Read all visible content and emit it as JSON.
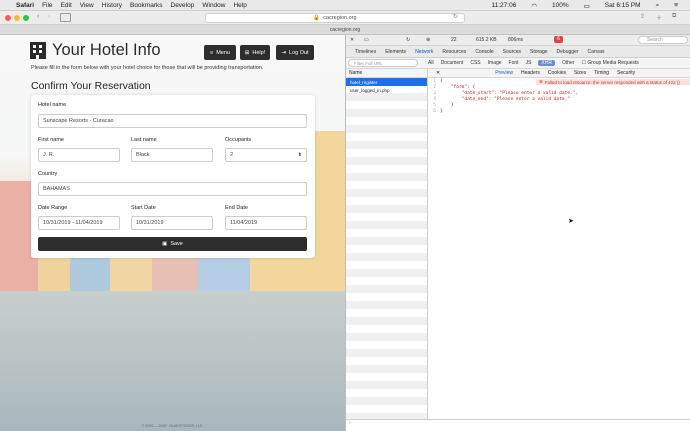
{
  "menubar": {
    "app_name": "Safari",
    "items": [
      "File",
      "Edit",
      "View",
      "History",
      "Bookmarks",
      "Develop",
      "Window",
      "Help"
    ],
    "status": {
      "time_small": "11:27:06",
      "battery": "100%",
      "clock": "Sat 6:15 PM"
    }
  },
  "browser": {
    "url": "cacregion.org",
    "tab_title": "cacregion.org"
  },
  "site": {
    "title": "Your Hotel Info",
    "nav": {
      "menu": "Menu",
      "help": "Help!",
      "logout": "Log Out"
    },
    "subtitle": "Please fill in the form below with your hotel choice for those that will be providing transportation.",
    "section_heading": "Confirm Your Reservation",
    "form": {
      "hotel_label": "Hotel name",
      "hotel_value": "Sunscape Resorts - Curacao",
      "first_label": "First name",
      "first_value": "J. R.",
      "last_label": "Last name",
      "last_value": "Black",
      "occupants_label": "Occupants",
      "occupants_value": "2",
      "country_label": "Country",
      "country_value": "BAHAMAS",
      "range_label": "Date Range",
      "range_value": "10/31/2019 - 11/04/2019",
      "start_label": "Start Date",
      "start_value": "10/31/2019",
      "end_label": "End Date",
      "end_value": "11/04/2019",
      "save_label": "Save"
    },
    "footer": "© 2009 — 2019 · BLAKSTUDIOS, LLC."
  },
  "devtools": {
    "top": {
      "count": "22",
      "size": "615.2 KB",
      "time": "806ms",
      "errors": "6"
    },
    "search_placeholder": "Search",
    "tabs": [
      "Timelines",
      "Elements",
      "Network",
      "Resources",
      "Console",
      "Sources",
      "Storage",
      "Debugger",
      "Canvas"
    ],
    "selected_tab": "Network",
    "filter_placeholder": "Filter Full URL",
    "filters": [
      "All",
      "Document",
      "CSS",
      "Image",
      "Font",
      "JS",
      "XHR",
      "Other"
    ],
    "selected_filter": "XHR",
    "group_media": "Group Media Requests",
    "list_header": "Name",
    "requests": [
      "hotel_register",
      "user_logged_in.php"
    ],
    "detail_tabs": [
      "Preview",
      "Headers",
      "Cookies",
      "Sizes",
      "Timing",
      "Security"
    ],
    "selected_detail_tab": "Preview",
    "error_message": "Failed to load resource: the server responded with a status of 422 ()",
    "code_lines": [
      {
        "no": "1",
        "text": "{"
      },
      {
        "no": "2",
        "text": "    \"form\": {"
      },
      {
        "no": "3",
        "text": "        \"date_start\": \"Please enter a valid date.\","
      },
      {
        "no": "4",
        "text": "        \"date_end\": \"Please enter a valid date.\""
      },
      {
        "no": "5",
        "text": "    }"
      },
      {
        "no": "6",
        "text": "}"
      }
    ]
  }
}
